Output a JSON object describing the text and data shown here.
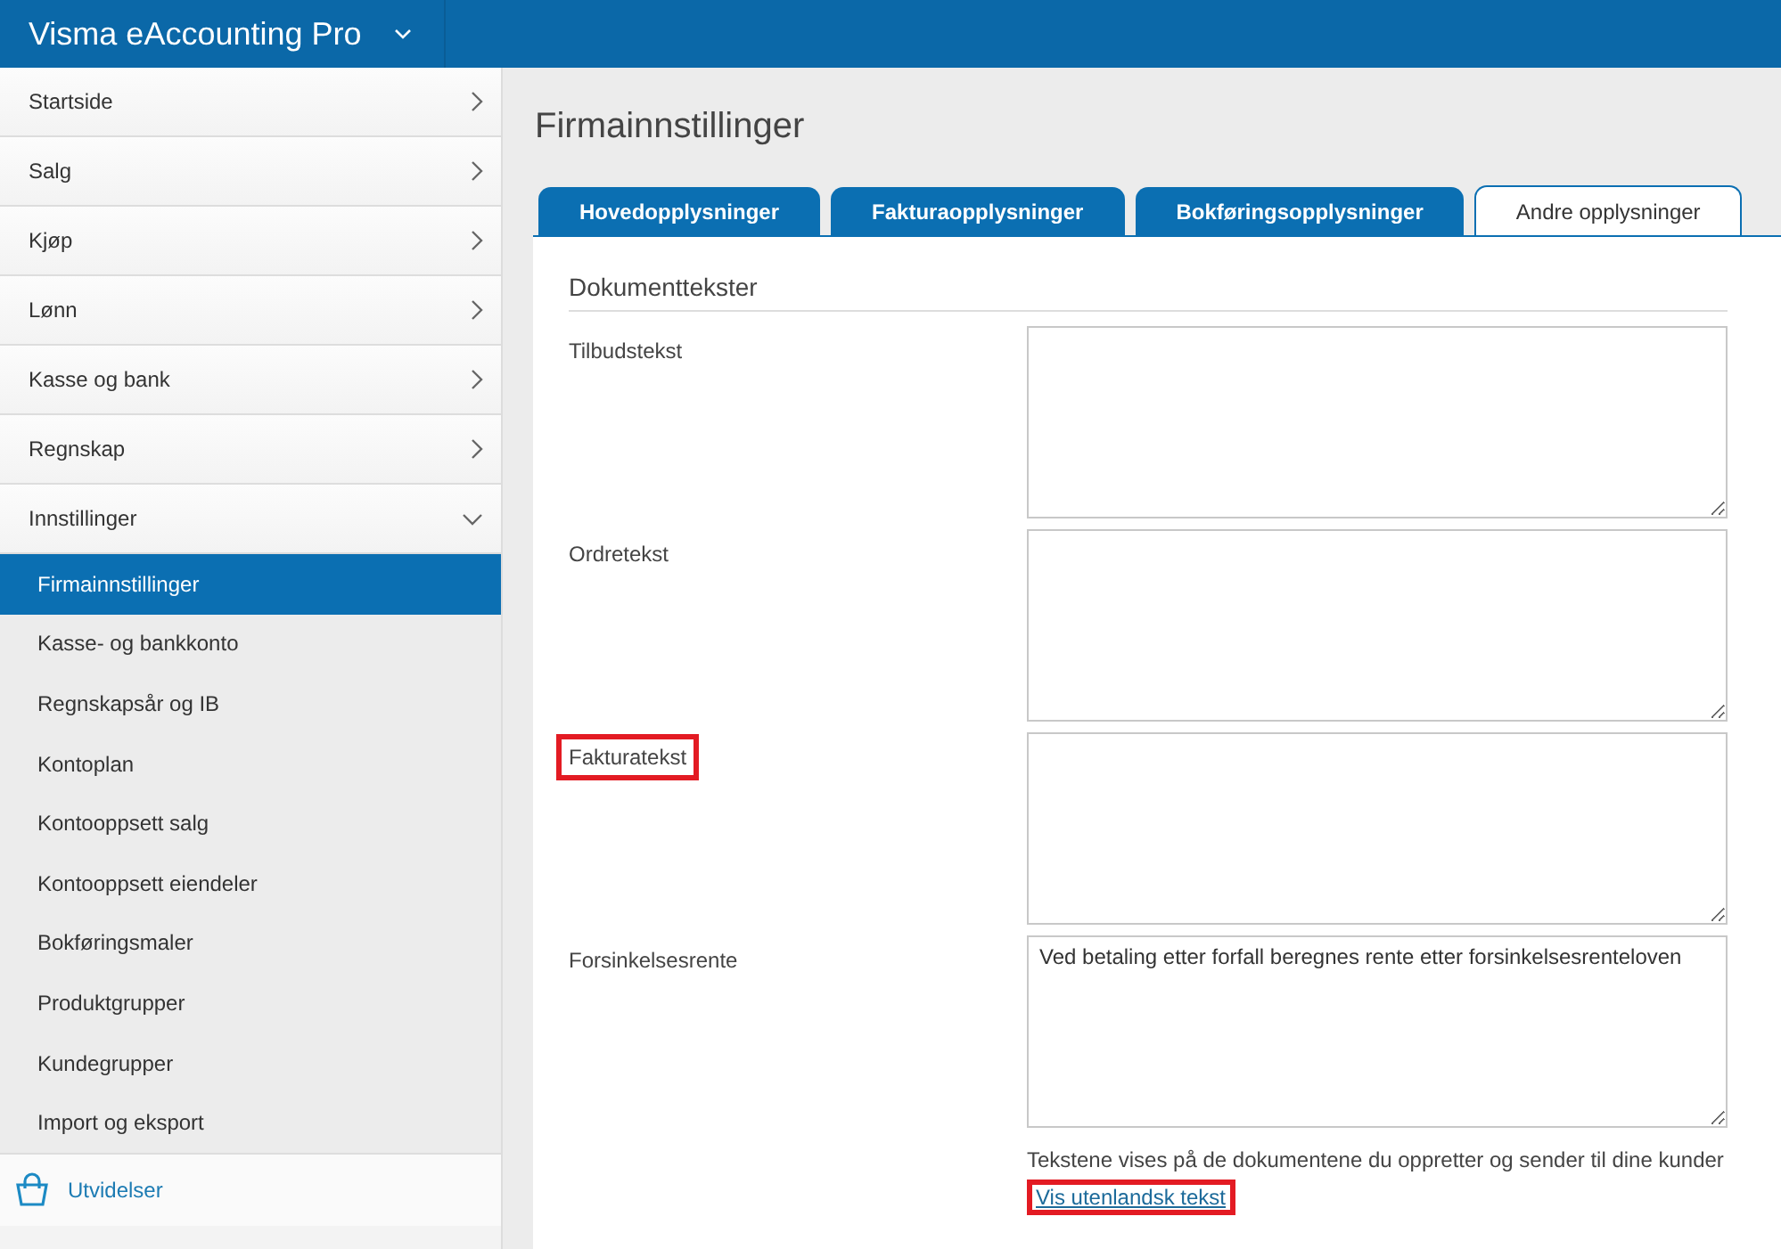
{
  "app": {
    "title": "Visma eAccounting Pro"
  },
  "sidebar": {
    "items": [
      {
        "label": "Startside",
        "expanded": false
      },
      {
        "label": "Salg",
        "expanded": false
      },
      {
        "label": "Kjøp",
        "expanded": false
      },
      {
        "label": "Lønn",
        "expanded": false
      },
      {
        "label": "Kasse og bank",
        "expanded": false
      },
      {
        "label": "Regnskap",
        "expanded": false
      },
      {
        "label": "Innstillinger",
        "expanded": true,
        "children": [
          {
            "label": "Firmainnstillinger",
            "selected": true
          },
          {
            "label": "Kasse- og bankkonto",
            "selected": false
          },
          {
            "label": "Regnskapsår og IB",
            "selected": false
          },
          {
            "label": "Kontoplan",
            "selected": false
          },
          {
            "label": "Kontooppsett salg",
            "selected": false
          },
          {
            "label": "Kontooppsett eiendeler",
            "selected": false
          },
          {
            "label": "Bokføringsmaler",
            "selected": false
          },
          {
            "label": "Produktgrupper",
            "selected": false
          },
          {
            "label": "Kundegrupper",
            "selected": false
          },
          {
            "label": "Import og eksport",
            "selected": false
          }
        ]
      }
    ],
    "extensions": "Utvidelser"
  },
  "page": {
    "title": "Firmainnstillinger"
  },
  "tabs": [
    {
      "label": "Hovedopplysninger",
      "selected": false
    },
    {
      "label": "Fakturaopplysninger",
      "selected": false
    },
    {
      "label": "Bokføringsopplysninger",
      "selected": false
    },
    {
      "label": "Andre opplysninger",
      "selected": true
    }
  ],
  "section": {
    "title": "Dokumenttekster",
    "fields": [
      {
        "label": "Tilbudstekst",
        "highlighted": false
      },
      {
        "label": "Ordretekst",
        "highlighted": false
      },
      {
        "label": "Fakturatekst",
        "highlighted": true
      },
      {
        "label": "Forsinkelsesrente",
        "value": "Ved betaling etter forfall beregnes rente etter forsinkelsesrenteloven",
        "highlighted": false
      }
    ],
    "note": "Tekstene vises på de dokumentene du oppretter og sender til dine kunder",
    "link": {
      "label": "Vis utenlandsk tekst",
      "highlighted": true
    }
  }
}
